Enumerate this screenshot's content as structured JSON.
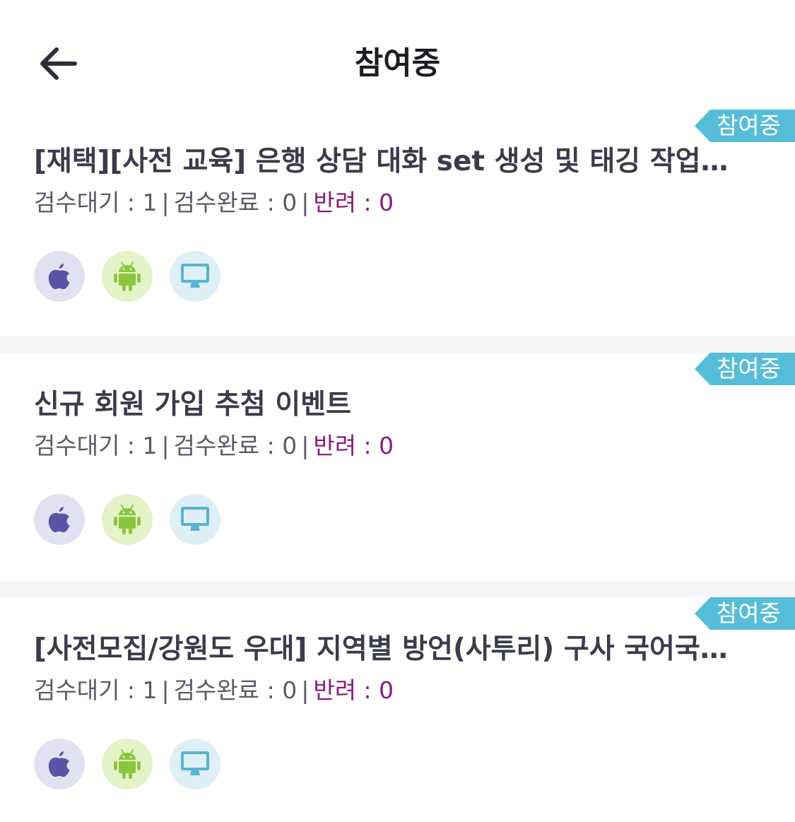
{
  "header": {
    "title": "참여중"
  },
  "cards": [
    {
      "badge": "참여중",
      "title": "[재택][사전 교육] 은행 상담 대화 set 생성 및 태깅 작업자...",
      "stats": {
        "pending_label": "검수대기 : 1",
        "done_label": "검수완료 : 0",
        "rejected_label": "반려 : 0",
        "separator": "|"
      },
      "platforms": [
        "apple-icon",
        "android-icon",
        "desktop-icon"
      ]
    },
    {
      "badge": "참여중",
      "title": "신규 회원 가입 추첨 이벤트",
      "stats": {
        "pending_label": "검수대기 : 1",
        "done_label": "검수완료 : 0",
        "rejected_label": "반려 : 0",
        "separator": "|"
      },
      "platforms": [
        "apple-icon",
        "android-icon",
        "desktop-icon"
      ]
    },
    {
      "badge": "참여중",
      "title": "[사전모집/강원도 우대] 지역별 방언(사투리) 구사 국어국문…",
      "stats": {
        "pending_label": "검수대기 : 1",
        "done_label": "검수완료 : 0",
        "rejected_label": "반려 : 0",
        "separator": "|"
      },
      "platforms": [
        "apple-icon",
        "android-icon",
        "desktop-icon"
      ]
    }
  ],
  "colors": {
    "badge_bg": "#56bdd8",
    "rejected_text": "#8a1b7c",
    "title_text": "#3a3b4c",
    "ios_bg": "#e2e1f1",
    "ios_fg": "#5a53a6",
    "android_bg": "#e4f3c8",
    "android_fg": "#8cc63f",
    "pc_bg": "#def0f6",
    "pc_fg": "#56b4cf"
  }
}
